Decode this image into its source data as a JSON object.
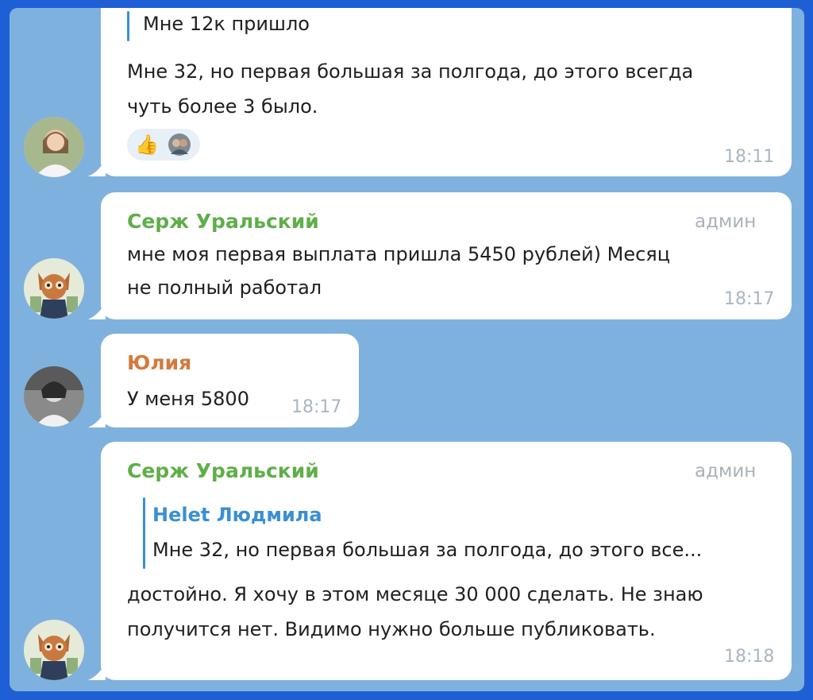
{
  "messages": [
    {
      "quote_text": "Мне 12к пришло",
      "lines": [
        "Мне 32, но первая большая за полгода, до этого  всегда",
        "чуть более 3 было."
      ],
      "reactions": [
        "thumbs-up-icon",
        "reactor-avatar"
      ],
      "time": "18:11"
    },
    {
      "author": "Серж Уральский",
      "role": "админ",
      "lines": [
        "мне моя первая выплата пришла 5450 рублей) Месяц",
        "не полный работал"
      ],
      "time": "18:17"
    },
    {
      "author": "Юлия",
      "lines": [
        "У меня 5800"
      ],
      "time": "18:17"
    },
    {
      "author": "Серж Уральский",
      "role": "админ",
      "quote_author": "Helet Людмила",
      "quote_text": "Мне 32, но первая большая за полгода, до этого  все...",
      "lines": [
        "достойно. Я хочу в этом месяце 30 000 сделать. Не знаю",
        "получится нет. Видимо нужно больше публиковать."
      ],
      "time": "18:18"
    }
  ],
  "colors": {
    "outer_border": "#1f5fd6",
    "chat_background": "#7fb1de",
    "bubble": "#ffffff",
    "name_green": "#5fae4a",
    "name_orange": "#d37a3c",
    "quote_blue": "#3a8fd2"
  }
}
